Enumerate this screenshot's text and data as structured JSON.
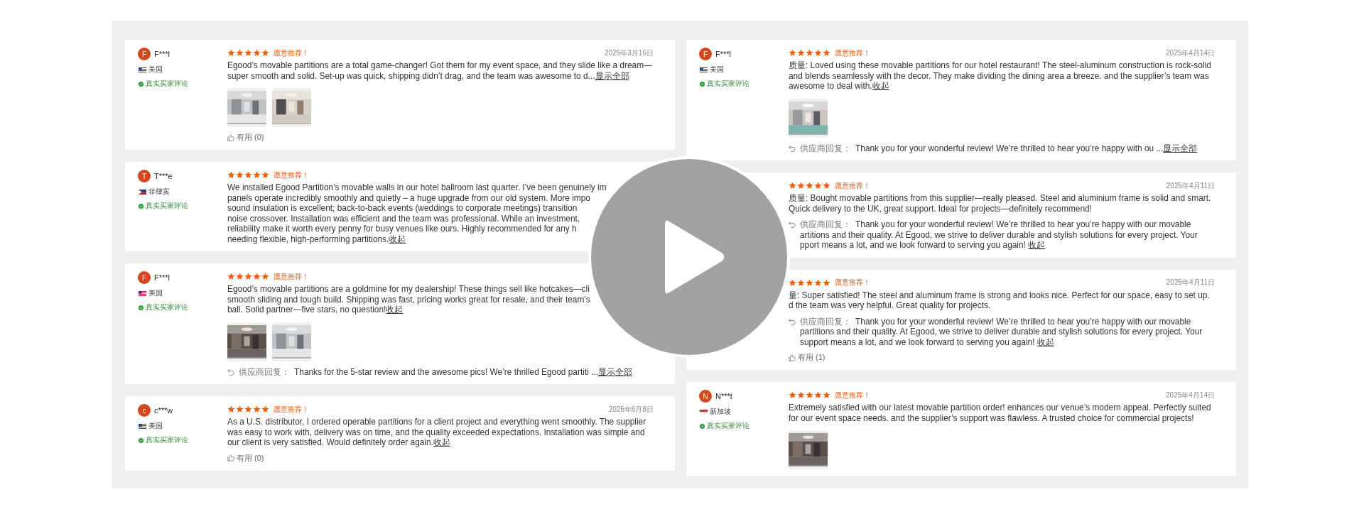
{
  "columns": [
    {
      "reviews": [
        {
          "user": {
            "initial": "F",
            "name": "F***l",
            "country": "美国",
            "flag": {
              "kind": "us"
            }
          },
          "verified": "真实买家评论",
          "stars": 5,
          "recommend": "愿意推荐！",
          "date": "2025年3月16日",
          "text": {
            "lines": [
              "Egood’s movable partitions are a total game-changer! Got them for my event space, and they slide like a dream—",
              "super smooth and solid. Set-up was quick, shipping didn’t drag, and the team was awesome to d..."
            ],
            "link": "显示全部"
          },
          "photos": [
            {
              "kind": "picture"
            },
            {
              "kind": "picture"
            }
          ],
          "helpful": {
            "label": "有用",
            "count": "(0)"
          }
        },
        {
          "user": {
            "initial": "T",
            "name": "T***e",
            "country": "菲律宾",
            "flag": {
              "kind": "ph"
            }
          },
          "verified": "真实买家评论",
          "stars": 5,
          "recommend": "愿意推荐！",
          "text": {
            "lines": [
              "We installed Egood Partition’s movable walls in our hotel ballroom last quarter. I’ve been genuinely im",
              "panels operate incredibly smoothly and quietly – a huge upgrade from our old system. More impo",
              "sound insulation is excellent; back-to-back events (weddings to corporate meetings) transition",
              "noise crossover. Installation was efficient and the team was professional. While an investment,",
              "reliability make it worth every penny for busy venues like ours. Highly recommended for any h",
              "needing flexible, high-performing partitions."
            ],
            "link": "收起"
          }
        },
        {
          "user": {
            "initial": "F",
            "name": "F***l",
            "country": "美国",
            "flag": {
              "kind": "us"
            }
          },
          "verified": "真实买家评论",
          "stars": 5,
          "recommend": "愿意推荐！",
          "text": {
            "lines": [
              "Egood’s movable partitions are a goldmine for my dealership! These things sell like hotcakes—cli",
              "smooth sliding and tough build. Shipping was fast, pricing works great for resale, and their team’s",
              "ball. Solid partner—five stars, no question!"
            ],
            "link": "收起"
          },
          "photos": [
            {
              "kind": "picture"
            },
            {
              "kind": "picture"
            }
          ],
          "reply": {
            "label": "供应商回复：",
            "lines": [
              "Thanks for the 5-star review and the awesome pics! We’re thrilled Egood partiti ..."
            ],
            "link": "显示全部"
          }
        },
        {
          "user": {
            "initial": "c",
            "name": "c***w",
            "country": "美国",
            "flag": {
              "kind": "us"
            }
          },
          "verified": "真实买家评论",
          "stars": 5,
          "recommend": "愿意推荐！",
          "date": "2025年6月8日",
          "text": {
            "lines": [
              "As a U.S. distributor, I ordered operable partitions for a client project and everything went smoothly. The supplier",
              "was easy to work with, delivery was on time, and the quality exceeded expectations. Installation was simple and",
              "our client is very satisfied. Would definitely order again."
            ],
            "link": "收起"
          },
          "helpful": {
            "label": "有用",
            "count": "(0)"
          }
        }
      ]
    },
    {
      "reviews": [
        {
          "user": {
            "initial": "F",
            "name": "F***l",
            "country": "美国",
            "flag": {
              "kind": "us"
            }
          },
          "verified": "真实买家评论",
          "stars": 5,
          "recommend": "愿意推荐！",
          "date": "2025年4月14日",
          "text": {
            "lines": [
              "质量: Loved using these movable partitions for our hotel restaurant! The steel-aluminum construction is rock-solid",
              "and blends seamlessly with the decor. They make dividing the dining area a breeze. and the supplier’s team was",
              "awesome to deal with."
            ],
            "link": "收起"
          },
          "photos": [
            {
              "kind": "picture"
            }
          ],
          "reply": {
            "label": "供应商回复：",
            "lines": [
              "Thank you for your wonderful review! We’re thrilled to hear you’re happy with ou ..."
            ],
            "link": "显示全部"
          }
        },
        {
          "stars": 5,
          "recommend": "愿意推荐！",
          "date": "2025年4月11日",
          "text": {
            "lines": [
              "质量: Bought movable partitions from this supplier—really pleased. Steel and aluminium frame is solid and smart.",
              "Quick delivery to the UK, great support. Ideal for projects—definitely recommend!"
            ]
          },
          "reply": {
            "label": "供应商回复：",
            "lines": [
              "Thank you for your wonderful review! We’re thrilled to hear you’re happy with our movable",
              "artitions and their quality. At Egood, we strive to deliver durable and stylish solutions for every project. Your",
              "pport means a lot, and we look forward to serving you again! "
            ],
            "link": "收起"
          }
        },
        {
          "stars": 5,
          "recommend": "愿意推荐！",
          "date": "2025年4月11日",
          "text": {
            "lines": [
              "量: Super satisfied! The steel and aluminum frame is strong and looks nice. Perfect for our space, easy to set up.",
              "d the team was very helpful. Great quality for projects."
            ]
          },
          "reply": {
            "label": "供应商回复：",
            "lines": [
              "Thank you for your wonderful review! We’re thrilled to hear you’re happy with our movable",
              "partitions and their quality. At Egood, we strive to deliver durable and stylish solutions for every project. Your",
              "support means a lot, and we look forward to serving you again! "
            ],
            "link": "收起"
          },
          "helpful": {
            "label": "有用",
            "count": "(1)"
          }
        },
        {
          "user": {
            "initial": "N",
            "name": "N***t",
            "country": "新加坡",
            "flag": {
              "kind": "sg"
            }
          },
          "verified": "真实买家评论",
          "stars": 5,
          "recommend": "愿意推荐！",
          "date": "2025年4月14日",
          "text": {
            "lines": [
              "Extremely satisfied with our latest movable partition order! enhances our venue’s modern appeal. Perfectly suited",
              "for our event space needs. and the supplier’s support was flawless. A trusted choice for commercial projects!"
            ]
          },
          "photos": [
            {
              "kind": "picture"
            }
          ]
        }
      ]
    }
  ]
}
